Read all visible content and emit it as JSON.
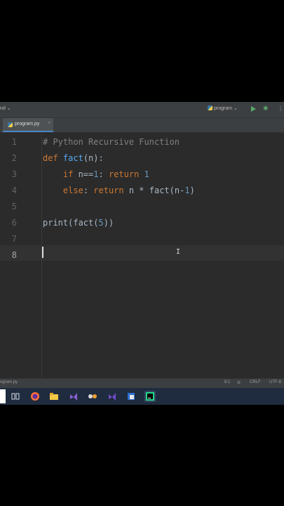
{
  "toolbar": {
    "vcs_label": "rol",
    "run_config_label": "program"
  },
  "tab": {
    "label": "program.py",
    "close": "×"
  },
  "editor": {
    "line_numbers": [
      "1",
      "2",
      "3",
      "4",
      "5",
      "6",
      "7",
      "8"
    ],
    "code": {
      "line1": "# Python Recursive Function",
      "line2_kw": "def",
      "line2_fn": "fact",
      "line2_rest": "(n):",
      "line3_indent": "    ",
      "line3_kw1": "if",
      "line3_cond": " n==",
      "line3_num1": "1",
      "line3_colon": ": ",
      "line3_kw2": "return",
      "line3_sp": " ",
      "line3_num2": "1",
      "line4_indent": "    ",
      "line4_kw1": "else",
      "line4_colon": ": ",
      "line4_kw2": "return",
      "line4_rest": " n * fact(n-",
      "line4_num": "1",
      "line4_close": ")",
      "line6_print": "print",
      "line6_mid": "(fact(",
      "line6_num": "5",
      "line6_close": "))"
    }
  },
  "statusbar": {
    "left": "ogram.py",
    "position": "8:1",
    "line_ending": "CRLF",
    "encoding": "UTF-8"
  },
  "colors": {
    "editor_bg": "#2b2b2b",
    "keyword": "#cc7832",
    "function": "#56a8f5",
    "number": "#6897bb",
    "comment": "#808080",
    "text": "#a9b7c6",
    "taskbar": "#1f2c3f"
  }
}
